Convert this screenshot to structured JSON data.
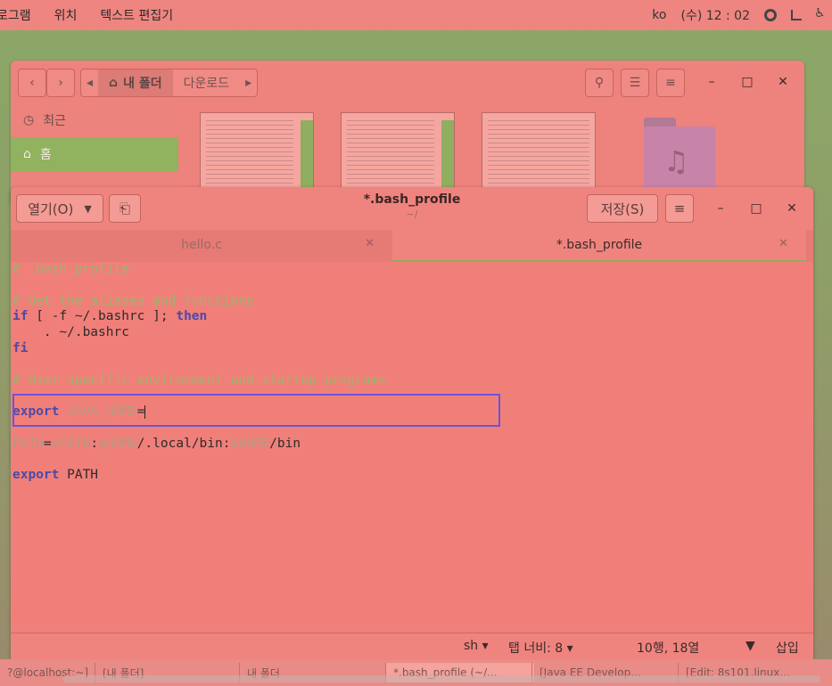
{
  "topbar": {
    "menu": [
      "로그램",
      "위치",
      "텍스트 편집기"
    ],
    "lang": "ko",
    "clock": "(수) 12 : 02"
  },
  "file_manager": {
    "breadcrumb_home": "내 폴더",
    "breadcrumb_current": "다운로드",
    "sidebar": [
      "최근",
      "홈"
    ]
  },
  "editor": {
    "open_label": "열기(O)",
    "title": "*.bash_profile",
    "subtitle": "~/",
    "save_label": "저장(S)",
    "tabs": [
      {
        "label": "hello.c",
        "active": false
      },
      {
        "label": "*.bash_profile",
        "active": true
      }
    ],
    "code_lines": [
      [
        {
          "t": "# .bash_profile",
          "c": "comment"
        }
      ],
      [],
      [
        {
          "t": "# Get the aliases and functions",
          "c": "comment"
        }
      ],
      [
        {
          "t": "if",
          "c": "kw"
        },
        {
          "t": " [ -f ~/.bashrc ]; ",
          "c": "txt"
        },
        {
          "t": "then",
          "c": "kw"
        }
      ],
      [
        {
          "t": "    . ~/.bashrc",
          "c": "txt"
        }
      ],
      [
        {
          "t": "fi",
          "c": "kw"
        }
      ],
      [],
      [
        {
          "t": "# User specific environment and startup programs",
          "c": "comment"
        }
      ],
      [],
      [
        {
          "t": "export",
          "c": "kw"
        },
        {
          "t": " JAVA_HOME",
          "c": "var"
        },
        {
          "t": "=",
          "c": "txt"
        },
        {
          "caret": true
        }
      ],
      [],
      [
        {
          "t": "PATH",
          "c": "var"
        },
        {
          "t": "=",
          "c": "txt"
        },
        {
          "t": "$PATH",
          "c": "var"
        },
        {
          "t": ":",
          "c": "txt"
        },
        {
          "t": "$HOME",
          "c": "var"
        },
        {
          "t": "/.local/bin:",
          "c": "txt"
        },
        {
          "t": "$HOME",
          "c": "var"
        },
        {
          "t": "/bin",
          "c": "txt"
        }
      ],
      [],
      [
        {
          "t": "export",
          "c": "kw"
        },
        {
          "t": " PATH",
          "c": "txt"
        }
      ]
    ],
    "status": {
      "lang": "sh ▾",
      "tab_width": "탭 너비: 8 ▾",
      "position": "10행, 18열",
      "mode": "삽입"
    }
  },
  "taskbar": [
    "?@localhost:~]",
    "[내 폴더]",
    "내 폴더",
    "*.bash_profile (~/...",
    "[Java EE Develop...",
    "[Edit: 8s101.linux..."
  ],
  "colors": {
    "accent": "#8db05d",
    "keyword": "#4c49a8",
    "comment": "#9bb46b",
    "highlight": "#6b54d8"
  }
}
